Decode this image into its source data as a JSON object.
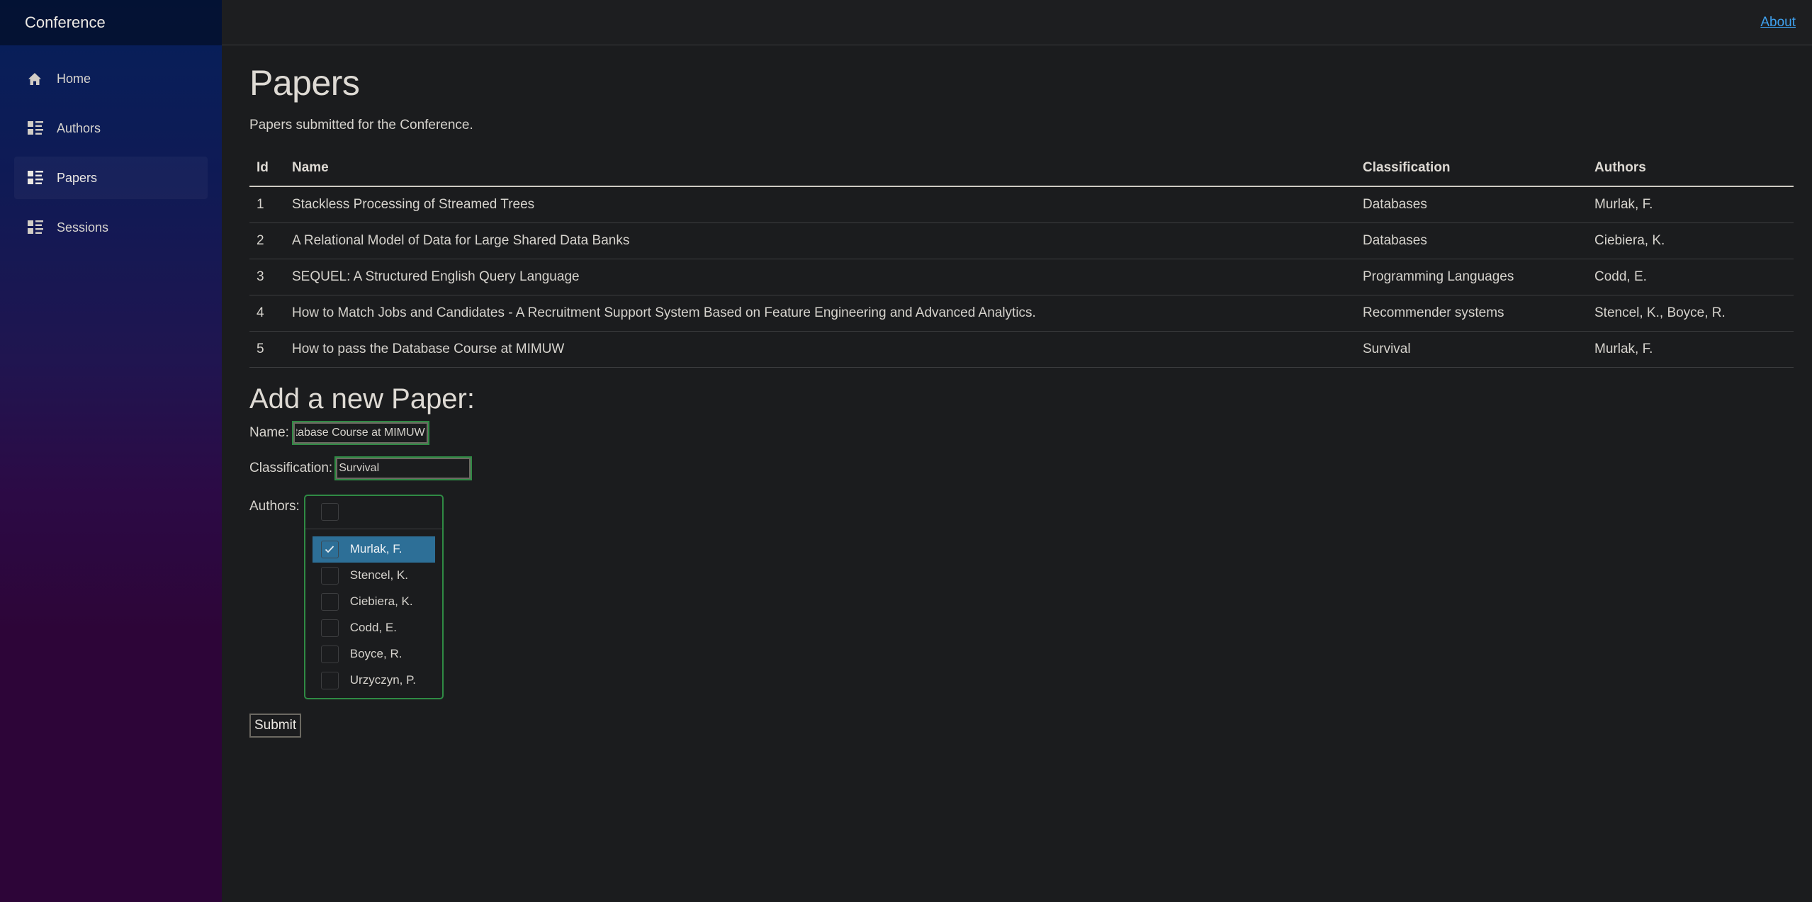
{
  "sidebar": {
    "brand": "Conference",
    "items": [
      {
        "label": "Home",
        "icon": "home-icon",
        "active": false
      },
      {
        "label": "Authors",
        "icon": "list-icon",
        "active": false
      },
      {
        "label": "Papers",
        "icon": "list-icon",
        "active": true
      },
      {
        "label": "Sessions",
        "icon": "list-icon",
        "active": false
      }
    ]
  },
  "topbar": {
    "about_link": "About"
  },
  "main": {
    "title": "Papers",
    "subtitle": "Papers submitted for the Conference.",
    "table": {
      "headers": [
        "Id",
        "Name",
        "Classification",
        "Authors"
      ],
      "rows": [
        [
          "1",
          "Stackless Processing of Streamed Trees",
          "Databases",
          "Murlak, F."
        ],
        [
          "2",
          "A Relational Model of Data for Large Shared Data Banks",
          "Databases",
          "Ciebiera, K."
        ],
        [
          "3",
          "SEQUEL: A Structured English Query Language",
          "Programming Languages",
          "Codd, E."
        ],
        [
          "4",
          "How to Match Jobs and Candidates - A Recruitment Support System Based on Feature Engineering and Advanced Analytics.",
          "Recommender systems",
          "Stencel, K., Boyce, R."
        ],
        [
          "5",
          "How to pass the Database Course at MIMUW",
          "Survival",
          "Murlak, F."
        ]
      ]
    },
    "form": {
      "title": "Add a new Paper:",
      "name_label": "Name:",
      "name_value": "How to pass the Database Course at MIMUW",
      "classification_label": "Classification:",
      "classification_value": "Survival",
      "authors_label": "Authors:",
      "authors_options": [
        {
          "label": "Murlak, F.",
          "checked": true
        },
        {
          "label": "Stencel, K.",
          "checked": false
        },
        {
          "label": "Ciebiera, K.",
          "checked": false
        },
        {
          "label": "Codd, E.",
          "checked": false
        },
        {
          "label": "Boyce, R.",
          "checked": false
        },
        {
          "label": "Urzyczyn, P.",
          "checked": false
        }
      ],
      "submit_label": "Submit"
    }
  },
  "colors": {
    "accent_link": "#3fa2f0",
    "selected_option": "#2d6f97",
    "focus_outline": "#2f8a44"
  }
}
